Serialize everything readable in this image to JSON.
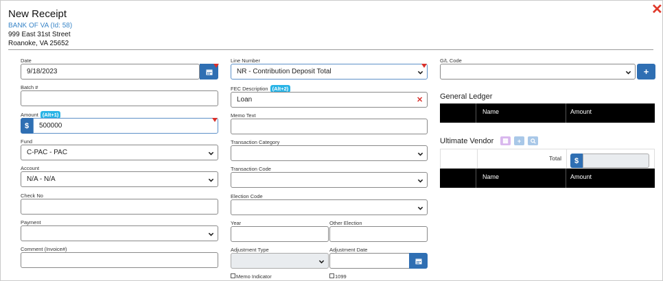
{
  "header": {
    "title": "New Receipt",
    "bank": "BANK OF VA (Id: 58)",
    "address_line1": "999 East 31st Street",
    "address_line2": "Roanoke, VA 25652"
  },
  "col1": {
    "date_label": "Date",
    "date_value": "9/18/2023",
    "batch_label": "Batch #",
    "batch_value": "",
    "amount_label": "Amount",
    "amount_badge": "(Alt+1)",
    "amount_prefix": "$",
    "amount_value": "500000",
    "fund_label": "Fund",
    "fund_value": "C-PAC - PAC",
    "account_label": "Account",
    "account_value": "N/A - N/A",
    "checkno_label": "Check No",
    "checkno_value": "",
    "payment_label": "Payment",
    "payment_value": "",
    "comment_label": "Comment (Invoice#)",
    "comment_value": ""
  },
  "col2": {
    "line_label": "Line Number",
    "line_value": "NR - Contribution Deposit Total",
    "fec_label": "FEC Description",
    "fec_badge": "(Alt+2)",
    "fec_value": "Loan",
    "memo_label": "Memo Text",
    "memo_value": "",
    "tcat_label": "Transaction Category",
    "tcat_value": "",
    "tcode_label": "Transaction Code",
    "tcode_value": "",
    "election_label": "Election Code",
    "election_value": "",
    "year_label": "Year",
    "year_value": "",
    "other_election_label": "Other Election",
    "other_election_value": "",
    "adj_type_label": "Adjustment Type",
    "adj_type_value": "",
    "adj_date_label": "Adjustment Date",
    "adj_date_value": "",
    "memo_indicator_label": "Memo Indicator",
    "label_1099": "1099"
  },
  "col3": {
    "gl_label": "G/L Code",
    "gl_value": "",
    "gl_add": "+",
    "general_ledger_title": "General Ledger",
    "gl_col_name": "Name",
    "gl_col_amount": "Amount",
    "vendor_title": "Ultimate Vendor",
    "total_label": "Total",
    "total_prefix": "$",
    "total_value": "",
    "uv_col_name": "Name",
    "uv_col_amount": "Amount"
  },
  "icons": {
    "close": "close-icon",
    "calendar": "calendar-icon",
    "chevron": "chevron-down-icon",
    "required": "required-flag-icon"
  },
  "colors": {
    "primary": "#2f6fb3",
    "badge": "#2ab4e6",
    "danger": "#d9302b"
  }
}
